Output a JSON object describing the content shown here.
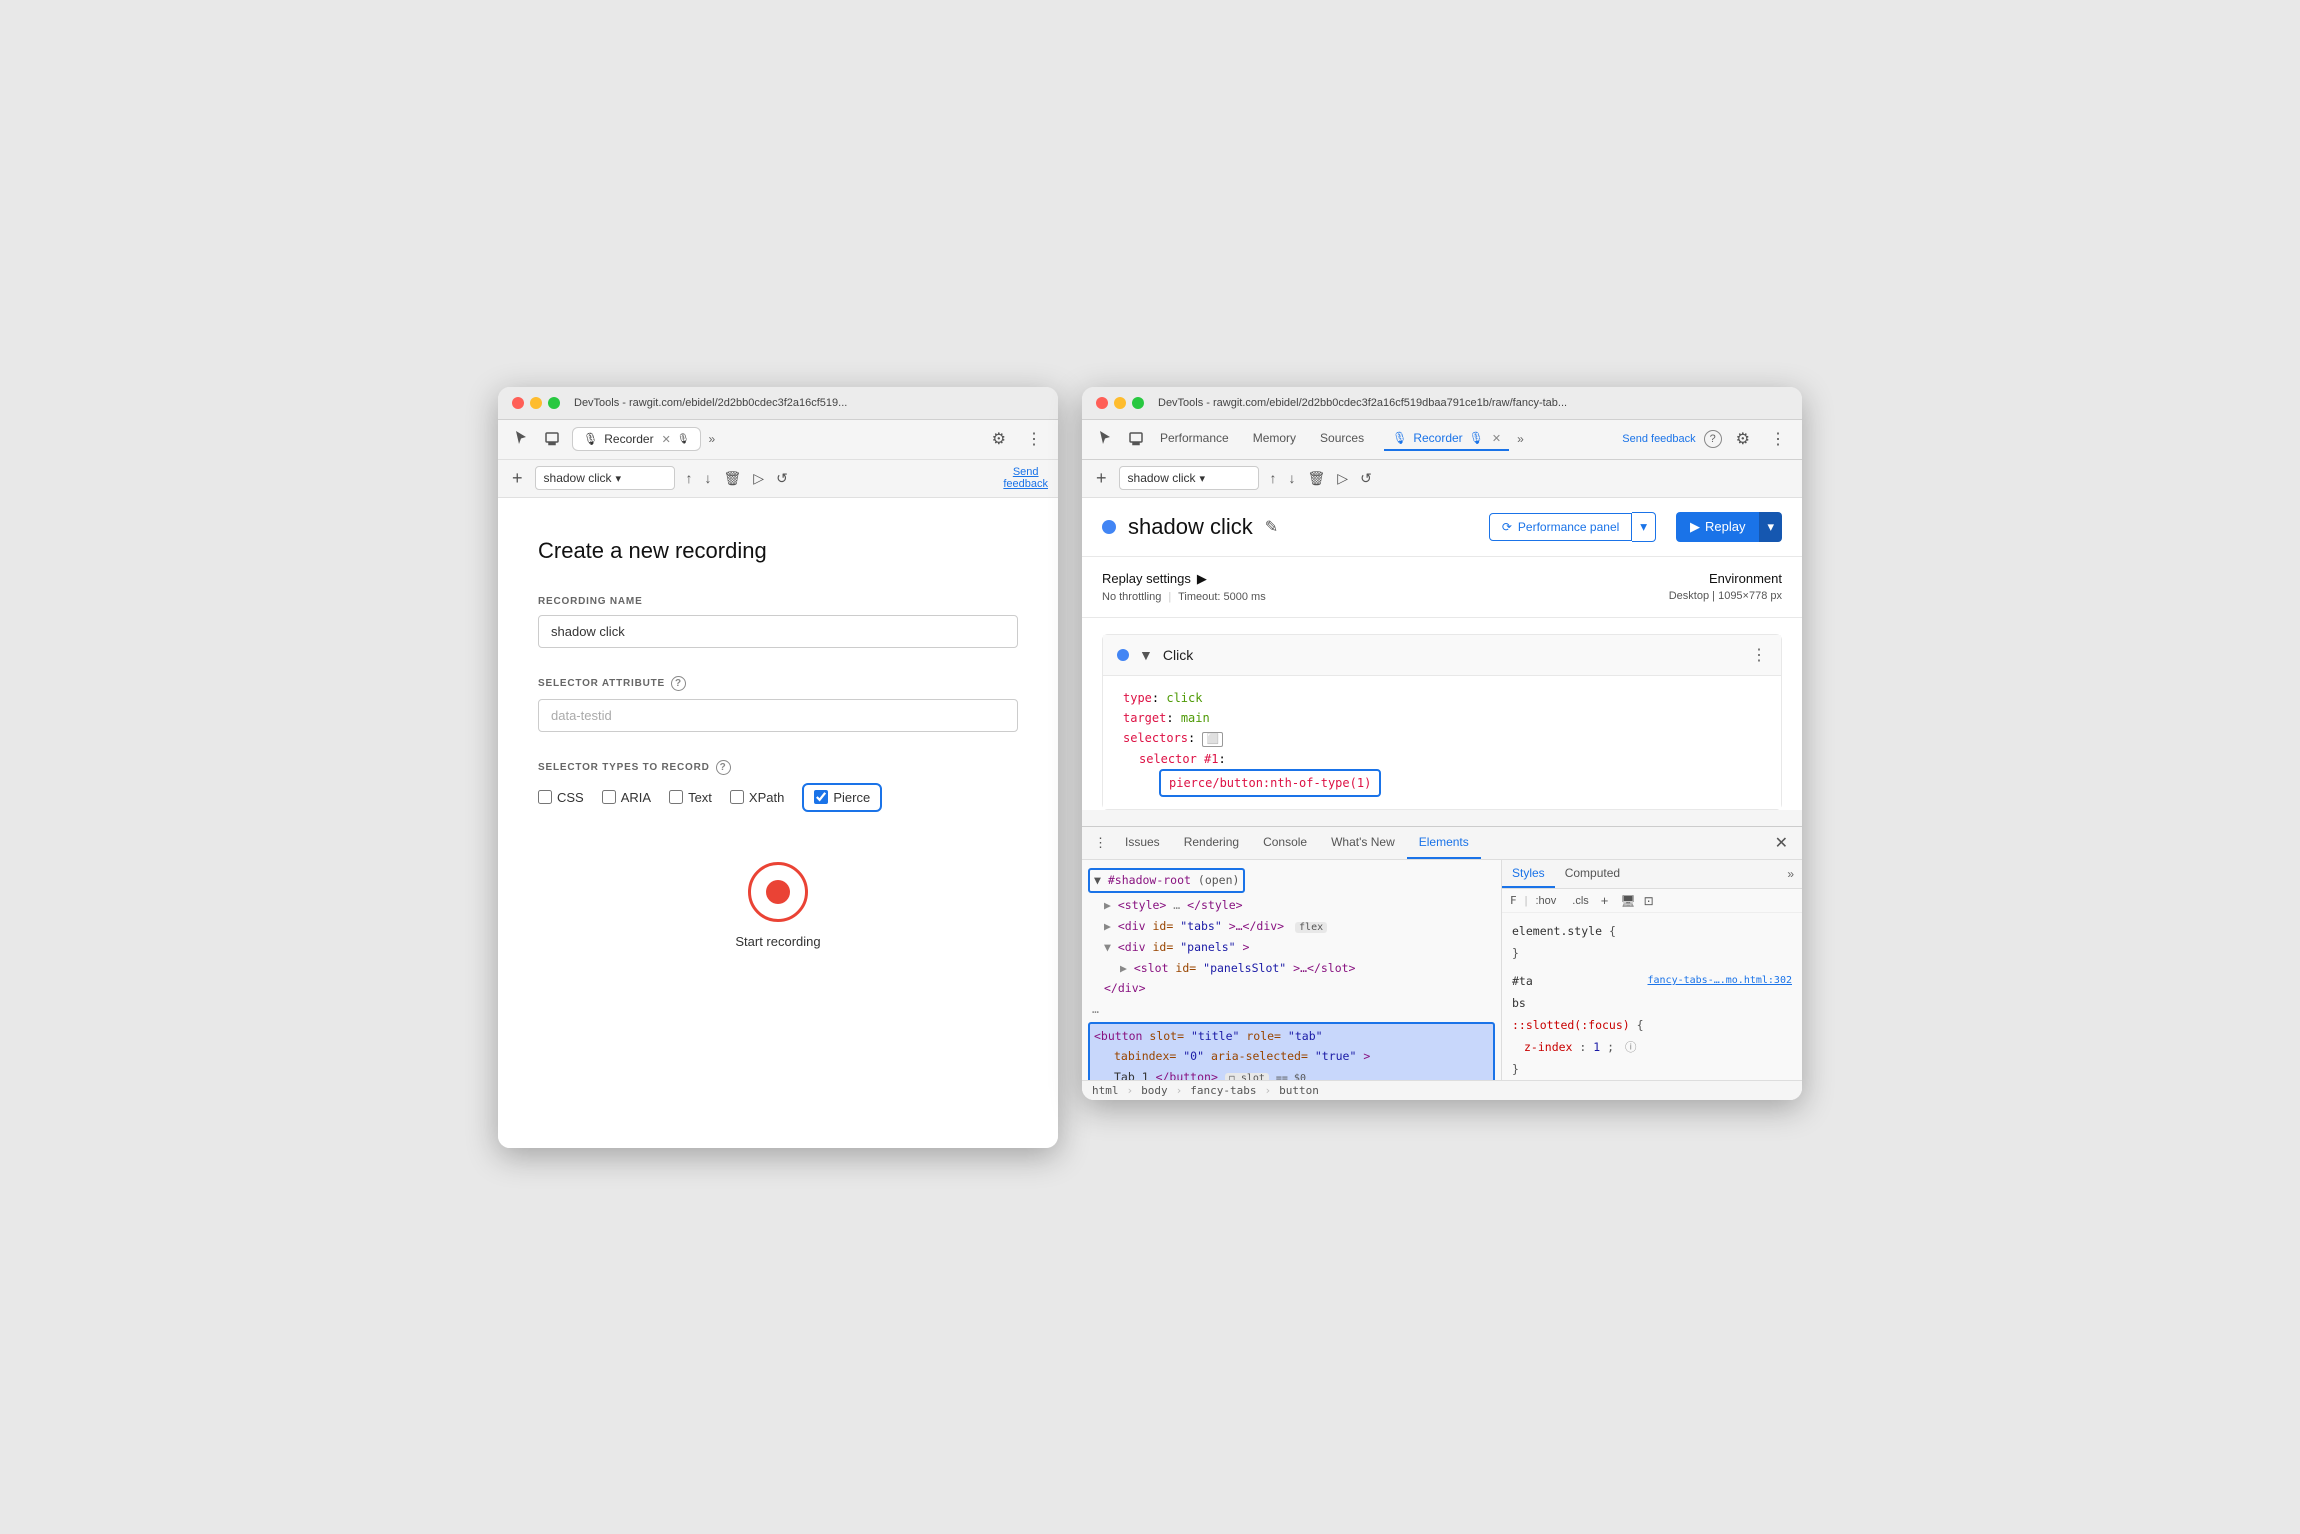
{
  "left_window": {
    "title": "DevTools - rawgit.com/ebidel/2d2bb0cdec3f2a16cf519...",
    "tab_label": "Recorder",
    "tab_icon": "🎙",
    "page_title": "Create a new recording",
    "recording_name_label": "RECORDING NAME",
    "recording_name_value": "shadow click",
    "selector_attr_label": "SELECTOR ATTRIBUTE",
    "selector_attr_placeholder": "data-testid",
    "selector_types_label": "SELECTOR TYPES TO RECORD",
    "checkboxes": [
      {
        "id": "css",
        "label": "CSS",
        "checked": false
      },
      {
        "id": "aria",
        "label": "ARIA",
        "checked": false
      },
      {
        "id": "text",
        "label": "Text",
        "checked": false
      },
      {
        "id": "xpath",
        "label": "XPath",
        "checked": false
      },
      {
        "id": "pierce",
        "label": "Pierce",
        "checked": true
      }
    ],
    "start_recording_label": "Start recording",
    "send_feedback_label": "Send\nfeedback",
    "dropdown_value": "shadow click"
  },
  "right_window": {
    "title": "DevTools - rawgit.com/ebidel/2d2bb0cdec3f2a16cf519dbaa791ce1b/raw/fancy-tab...",
    "nav_tabs": [
      "Performance",
      "Memory",
      "Sources"
    ],
    "tab_label": "Recorder",
    "send_feedback_label": "Send feedback",
    "recording_dropdown": "shadow click",
    "shadow_click_title": "shadow click",
    "perf_panel_label": "Performance panel",
    "replay_label": "Replay",
    "replay_settings_title": "Replay settings",
    "replay_settings_detail_throttling": "No throttling",
    "replay_settings_detail_timeout": "Timeout: 5000 ms",
    "environment_title": "Environment",
    "environment_detail": "Desktop",
    "environment_size": "1095×778 px",
    "step_title": "Click",
    "code_lines": {
      "type": "type: click",
      "target": "target: main",
      "selectors": "selectors:",
      "selector_num": "selector #1:",
      "selector_val": "pierce/button:nth-of-type(1)"
    }
  },
  "devtools": {
    "tabs": [
      "Issues",
      "Rendering",
      "Console",
      "What's New",
      "Elements"
    ],
    "active_tab": "Elements",
    "dom_lines": [
      {
        "text": "▼ #shadow-root",
        "type": "shadow",
        "highlight": true
      },
      {
        "text": "  <style>…</style>",
        "type": "tag"
      },
      {
        "text": "  ▶ <div id=\"tabs\">…</div>",
        "type": "tag",
        "pill": "flex"
      },
      {
        "text": "  ▼ <div id=\"panels\">",
        "type": "tag"
      },
      {
        "text": "    ▶ <slot id=\"panelsSlot\">…</slot>",
        "type": "tag"
      },
      {
        "text": "    </div>",
        "type": "tag"
      },
      {
        "text": "…",
        "type": "more"
      },
      {
        "text": "<button slot=\"title\" role=\"tab\" tabindex=\"0\" aria-selected=\"true\">",
        "type": "selected"
      },
      {
        "text": "  Tab 1</button>",
        "type": "selected2"
      }
    ],
    "breadcrumb": [
      "html",
      "body",
      "fancy-tabs",
      "button"
    ],
    "styles_tabs": [
      "Styles",
      "Computed"
    ],
    "styles_filter": {
      "f": "F",
      "hov": ":hov",
      "cls": ".cls"
    },
    "style_rule_element": "element.style {",
    "style_rule_close": "}",
    "style_rule_source": "fancy-tabs-….mo.html:302",
    "style_selector": "#ta\nbs",
    "style_pseudo": "::slotted(:focus) {",
    "style_prop": "z-index:",
    "style_val": "1;",
    "style_info": "ⓘ",
    "style_close2": "}"
  }
}
